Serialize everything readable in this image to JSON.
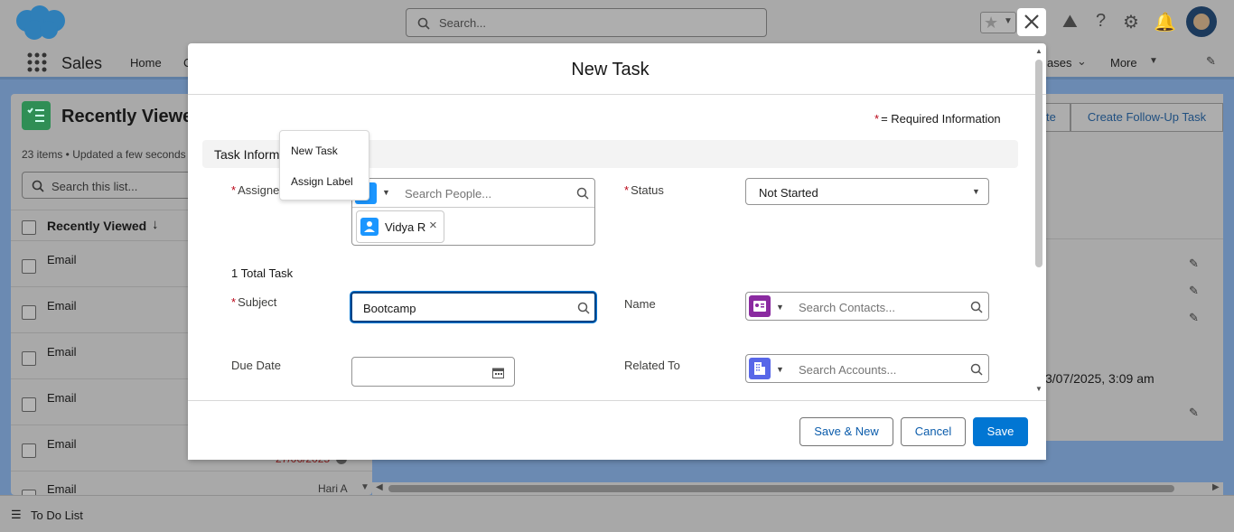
{
  "header": {
    "search_placeholder": "Search..."
  },
  "nav": {
    "app_name": "Sales",
    "home": "Home",
    "cut_item": "C",
    "cases": "ases",
    "more": "More"
  },
  "list": {
    "title": "Recently Viewe",
    "meta": "23 items • Updated a few seconds",
    "search_placeholder": "Search this list...",
    "column": "Recently Viewed",
    "rows": [
      "Email",
      "Email",
      "Email",
      "Email",
      "Email",
      "Email"
    ],
    "overdue_date": "27/06/2025",
    "assignee": "Hari A"
  },
  "right_panel": {
    "btn1": "te",
    "btn2": "Create Follow-Up Task",
    "timestamp": "3/07/2025, 3:09 am"
  },
  "footer": {
    "todo": "To Do List"
  },
  "modal": {
    "title": "New Task",
    "required_note": "= Required Information",
    "section": "Task Informa",
    "assigned_label": "Assigne",
    "people_placeholder": "Search People...",
    "assignee_pill": "Vidya R",
    "total": "1 Total Task",
    "subject_label": "Subject",
    "subject_value": "Bootcamp",
    "due_label": "Due Date",
    "status_label": "Status",
    "status_value": "Not Started",
    "name_label": "Name",
    "contacts_placeholder": "Search Contacts...",
    "related_label": "Related To",
    "accounts_placeholder": "Search Accounts...",
    "save_new": "Save & New",
    "cancel": "Cancel",
    "save": "Save"
  },
  "popover": {
    "item1": "New Task",
    "item2": "Assign Label"
  },
  "colors": {
    "brand": "#0176d3",
    "required": "#ba0517",
    "contact_icon": "#8a2aa0",
    "account_icon": "#5867e8"
  }
}
